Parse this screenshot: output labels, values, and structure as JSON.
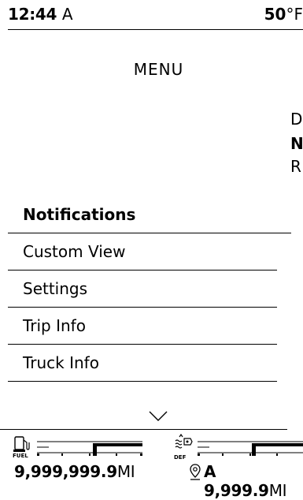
{
  "status": {
    "time": "12:44",
    "time_suffix": "A",
    "temperature": "50",
    "temperature_unit": "°F"
  },
  "menu": {
    "title": "MENU",
    "items": [
      {
        "label": "Notifications",
        "active": true
      },
      {
        "label": "Custom View"
      },
      {
        "label": "Settings"
      },
      {
        "label": "Trip Info"
      },
      {
        "label": "Truck Info"
      }
    ]
  },
  "gear_selector": {
    "gears": [
      "D",
      "N",
      "R"
    ],
    "selected": "N"
  },
  "gauges": {
    "fuel": {
      "label": "FUEL",
      "icon": "fuel-pump-icon",
      "level": 0.5
    },
    "def": {
      "label": "DEF",
      "icon": "def-fluid-icon",
      "level": 0.5
    }
  },
  "odometer": {
    "value": "9,999,999.9",
    "unit": "MI"
  },
  "trip": {
    "icon": "map-pin-icon",
    "label": "A",
    "value": "9,999.9",
    "unit": "MI"
  }
}
